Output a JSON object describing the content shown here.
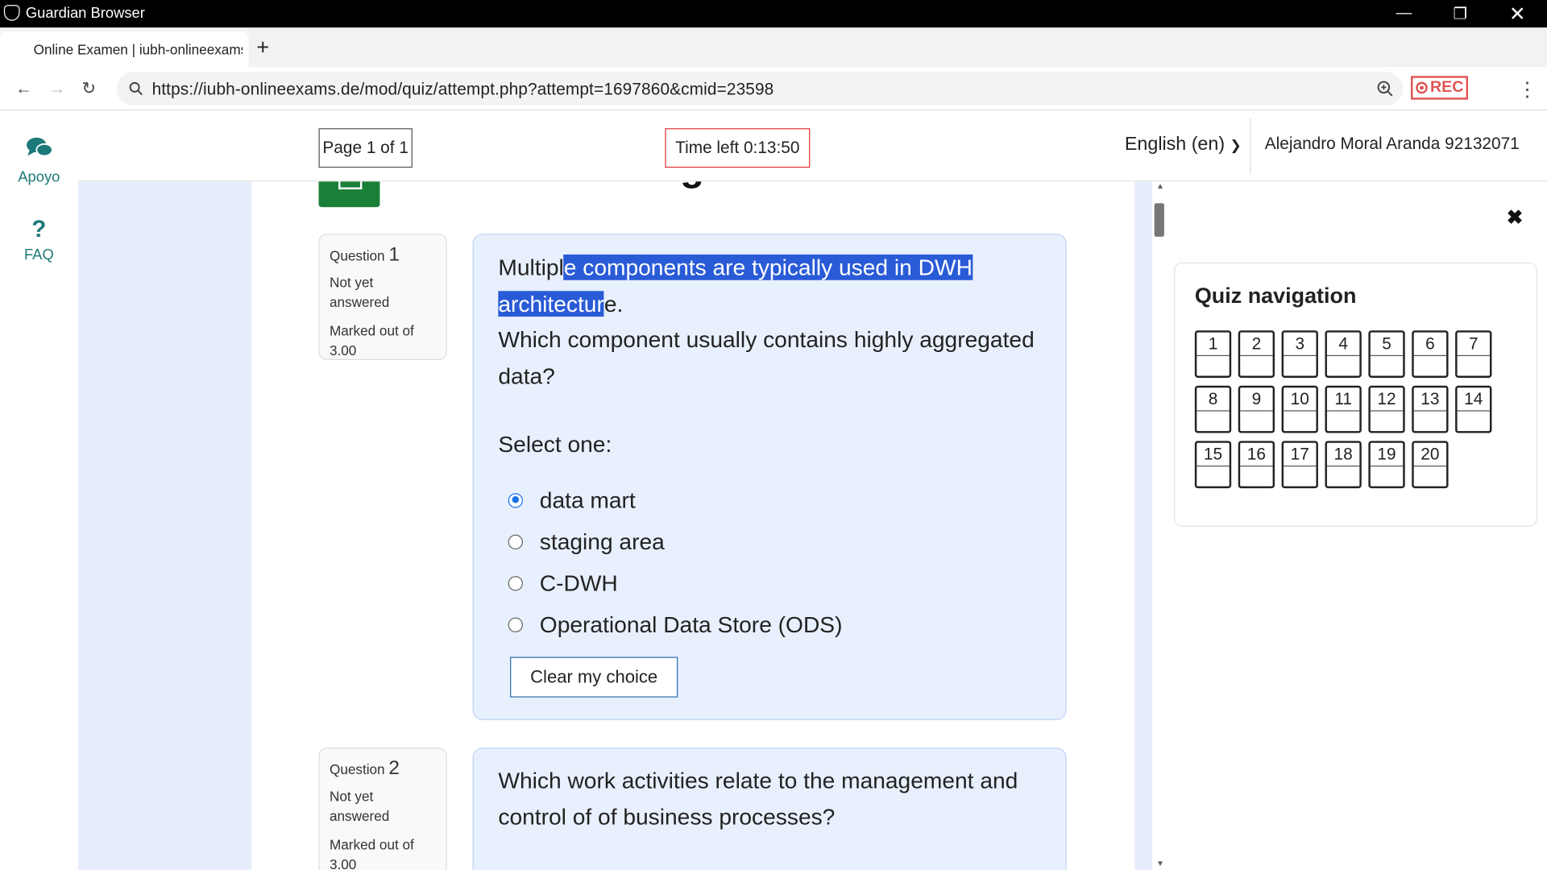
{
  "window": {
    "app_name": "Guardian Browser"
  },
  "tab": {
    "title": "Online Examen | iubh-onlineexams.de",
    "new_tab_label": "+"
  },
  "address": {
    "url": "https://iubh-onlineexams.de/mod/quiz/attempt.php?attempt=1697860&cmid=23598",
    "rec_label": "REC"
  },
  "sidebar": {
    "items": [
      {
        "label": "Apoyo",
        "icon": "chat-bubbles-icon"
      },
      {
        "label": "FAQ",
        "icon": "question-icon"
      }
    ]
  },
  "header": {
    "page_indicator": "Page 1 of 1",
    "time_left": "Time left 0:13:50",
    "language": "English (en)",
    "user": "Alejandro Moral Aranda 92132071"
  },
  "course": {
    "title": "Business Intelligence"
  },
  "questions": [
    {
      "label": "Question",
      "number": "1",
      "state": "Not yet answered",
      "marks": "Marked out of 3.00",
      "text_before": "Multipl",
      "text_highlight": "e components are typically used in DWH architectur",
      "text_after": "e.",
      "prompt": "Which component usually contains highly aggregated data?",
      "select_label": "Select one:",
      "options": [
        "data mart",
        "staging area",
        "C-DWH",
        "Operational Data Store (ODS)"
      ],
      "selected": 0,
      "clear_label": "Clear my choice"
    },
    {
      "label": "Question",
      "number": "2",
      "state": "Not yet answered",
      "marks": "Marked out of 3.00",
      "text": "Which work activities relate to the management and control of of business processes?"
    }
  ],
  "quiz_nav": {
    "title": "Quiz navigation",
    "close_icon": "close-icon",
    "pages": [
      "1",
      "2",
      "3",
      "4",
      "5",
      "6",
      "7",
      "8",
      "9",
      "10",
      "11",
      "12",
      "13",
      "14",
      "15",
      "16",
      "17",
      "18",
      "19",
      "20"
    ]
  },
  "colors": {
    "accent_blue": "#1a73e8",
    "highlight": "#2a5bd7",
    "rec_red": "#e05555",
    "course_green": "#1a7f37",
    "sidebar_teal": "#1e7a7a"
  }
}
